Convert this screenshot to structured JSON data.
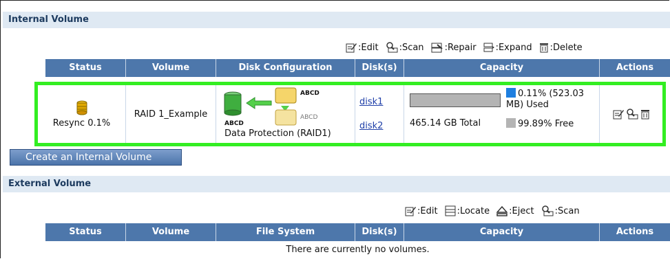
{
  "internal": {
    "title": "Internal Volume",
    "legend": {
      "edit": ":Edit",
      "scan": ":Scan",
      "repair": ":Repair",
      "expand": ":Expand",
      "delete": ":Delete"
    },
    "columns": [
      "Status",
      "Volume",
      "Disk Configuration",
      "Disk(s)",
      "Capacity",
      "Actions"
    ],
    "rows": [
      {
        "status": "Resync 0.1%",
        "volume": "RAID 1_Example",
        "disk_config_tag1": "ABCD",
        "disk_config_tag2": "ABCD",
        "disk_config_tag3": "ABCD",
        "disk_config_label": "Data Protection (RAID1)",
        "disks": [
          "disk1",
          "disk2"
        ],
        "used_text": "0.11% (523.03 MB) Used",
        "used_fraction": 0.0011,
        "total_text": "465.14 GB Total",
        "free_text": "99.89% Free"
      }
    ],
    "create_button": "Create an Internal Volume"
  },
  "external": {
    "title": "External Volume",
    "legend": {
      "edit": ":Edit",
      "locate": ":Locate",
      "eject": ":Eject",
      "scan": ":Scan"
    },
    "columns": [
      "Status",
      "Volume",
      "File System",
      "Disk(s)",
      "Capacity",
      "Actions"
    ],
    "empty_text": "There are currently no volumes."
  },
  "colors": {
    "header": "#4d77ab",
    "section": "#dfe9f3",
    "highlight": "#33ee22",
    "used": "#1e7fe0",
    "free": "#b4b4b4"
  }
}
